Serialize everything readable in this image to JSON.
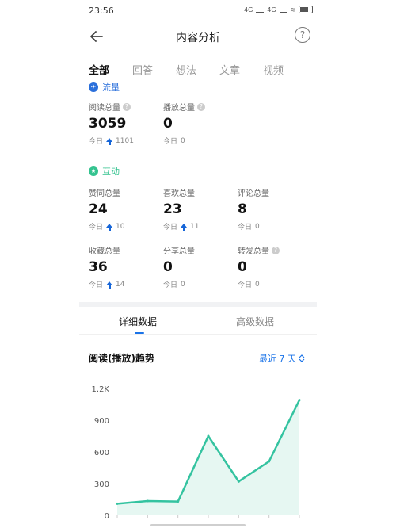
{
  "status_bar": {
    "time": "23:56",
    "signal1": "4G",
    "signal2": "4G"
  },
  "header": {
    "title": "内容分析"
  },
  "tabs": [
    {
      "label": "全部",
      "active": true
    },
    {
      "label": "回答",
      "active": false
    },
    {
      "label": "想法",
      "active": false
    },
    {
      "label": "文章",
      "active": false
    },
    {
      "label": "视频",
      "active": false
    }
  ],
  "traffic": {
    "label": "流量",
    "color": "#2a6fdb",
    "metrics": [
      {
        "label": "阅读总量",
        "value": "3059",
        "today_label": "今日",
        "today": "1101",
        "up": true,
        "help": true
      },
      {
        "label": "播放总量",
        "value": "0",
        "today_label": "今日",
        "today": "0",
        "up": false,
        "help": true
      }
    ]
  },
  "interaction": {
    "label": "互动",
    "color": "#34c38f",
    "metrics": [
      {
        "label": "赞同总量",
        "value": "24",
        "today_label": "今日",
        "today": "10",
        "up": true,
        "help": false
      },
      {
        "label": "喜欢总量",
        "value": "23",
        "today_label": "今日",
        "today": "11",
        "up": true,
        "help": false
      },
      {
        "label": "评论总量",
        "value": "8",
        "today_label": "今日",
        "today": "0",
        "up": false,
        "help": false
      },
      {
        "label": "收藏总量",
        "value": "36",
        "today_label": "今日",
        "today": "14",
        "up": true,
        "help": false
      },
      {
        "label": "分享总量",
        "value": "0",
        "today_label": "今日",
        "today": "0",
        "up": false,
        "help": false
      },
      {
        "label": "转发总量",
        "value": "0",
        "today_label": "今日",
        "today": "0",
        "up": false,
        "help": true
      }
    ]
  },
  "subtabs": {
    "active": "详细数据",
    "inactive": "高级数据"
  },
  "trend": {
    "title": "阅读(播放)趋势",
    "range": "最近 7 天"
  },
  "chart_data": {
    "type": "area",
    "title": "阅读(播放)趋势",
    "x": [
      1,
      2,
      3,
      4,
      5,
      6,
      7
    ],
    "series": [
      {
        "values": [
          110,
          135,
          130,
          750,
          320,
          510,
          1090
        ]
      }
    ],
    "ylim": [
      0,
      1200
    ],
    "yticks": [
      "0",
      "300",
      "600",
      "900",
      "1.2K"
    ],
    "ytick_values": [
      0,
      300,
      600,
      900,
      1200
    ],
    "grid": false,
    "color": "#34c3a0"
  }
}
